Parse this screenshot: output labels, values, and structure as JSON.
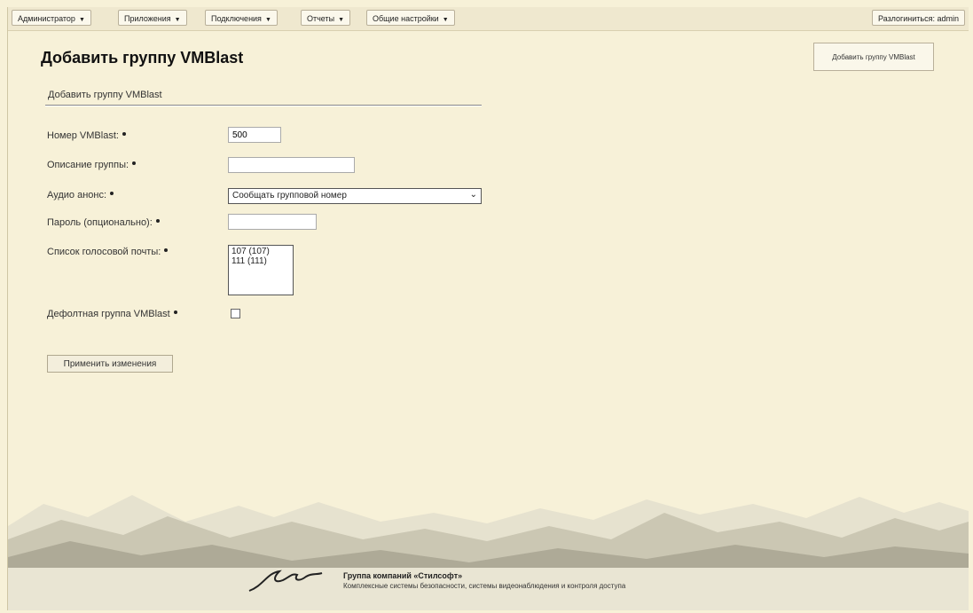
{
  "topbar": {
    "menus": [
      {
        "label": "Администратор"
      },
      {
        "label": "Приложения"
      },
      {
        "label": "Подключения"
      },
      {
        "label": "Отчеты"
      },
      {
        "label": "Общие настройки"
      }
    ],
    "logout_label": "Разлогиниться: admin"
  },
  "page": {
    "title": "Добавить группу VMBlast",
    "top_button": "Добавить группу VMBlast",
    "section_title": "Добавить группу VMBlast"
  },
  "form": {
    "number_label": "Номер VMBlast:",
    "number_value": "500",
    "description_label": "Описание группы:",
    "description_value": "",
    "audio_label": "Аудио анонс:",
    "audio_selected": "Сообщать групповой номер",
    "password_label": "Пароль (опционально):",
    "password_value": "",
    "voicemail_label": "Список голосовой почты:",
    "voicemail_options": [
      "107 (107)",
      "111 (111)"
    ],
    "default_label": "Дефолтная группа VMBlast",
    "default_checked": false,
    "apply_label": "Применить изменения"
  },
  "footer": {
    "brand": "Группа компаний «Стилсофт»",
    "tagline": "Комплексные системы безопасности, системы видеонаблюдения и контроля доступа"
  },
  "colors": {
    "background": "#f7f1d8",
    "mountain_light": "#e4e0cc",
    "mountain_dark": "#a7a391"
  }
}
